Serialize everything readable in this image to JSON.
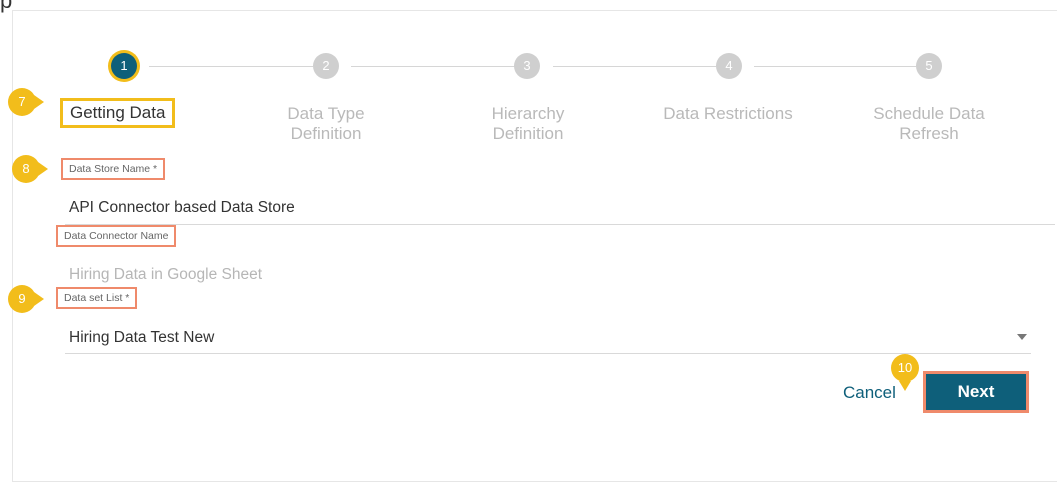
{
  "header_fragment": "p",
  "steps": [
    {
      "number": "1",
      "label": "Getting Data"
    },
    {
      "number": "2",
      "label_line1": "Data Type",
      "label_line2": "Definition"
    },
    {
      "number": "3",
      "label_line1": "Hierarchy",
      "label_line2": "Definition"
    },
    {
      "number": "4",
      "label": "Data Restrictions"
    },
    {
      "number": "5",
      "label_line1": "Schedule Data",
      "label_line2": "Refresh"
    }
  ],
  "callouts": {
    "c7": "7",
    "c8": "8",
    "c9": "9",
    "c10": "10"
  },
  "form": {
    "data_store_name": {
      "label": "Data Store Name *",
      "value": "API Connector based Data Store"
    },
    "data_connector_name": {
      "label": "Data Connector Name",
      "value": "Hiring Data in Google Sheet"
    },
    "data_set_list": {
      "label": "Data set List *",
      "value": "Hiring Data Test New"
    }
  },
  "actions": {
    "cancel_label": "Cancel",
    "next_label": "Next"
  },
  "colors": {
    "accent": "#0e5f7a",
    "callout": "#f2bd1b",
    "highlight": "#ef8a6b"
  }
}
